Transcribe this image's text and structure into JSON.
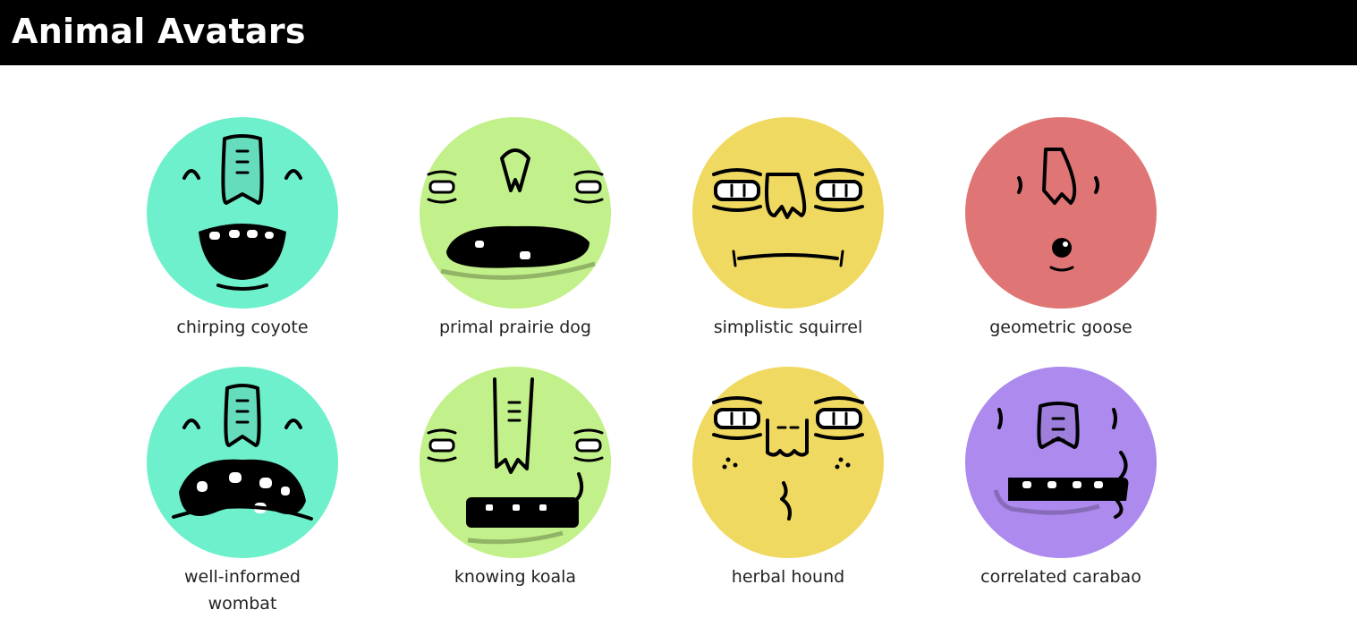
{
  "header": {
    "title": "Animal Avatars"
  },
  "avatars": [
    {
      "name": "chirping coyote",
      "color": "#6ef0cc",
      "face": "coyote"
    },
    {
      "name": "primal prairie dog",
      "color": "#c2f08a",
      "face": "prairie"
    },
    {
      "name": "simplistic squirrel",
      "color": "#f0d960",
      "face": "squirrel"
    },
    {
      "name": "geometric goose",
      "color": "#e07575",
      "face": "goose"
    },
    {
      "name": "well-informed wombat",
      "color": "#6ef0cc",
      "face": "wombat"
    },
    {
      "name": "knowing koala",
      "color": "#c2f08a",
      "face": "koala"
    },
    {
      "name": "herbal hound",
      "color": "#f0d960",
      "face": "hound"
    },
    {
      "name": "correlated carabao",
      "color": "#ac8aee",
      "face": "carabao"
    }
  ]
}
